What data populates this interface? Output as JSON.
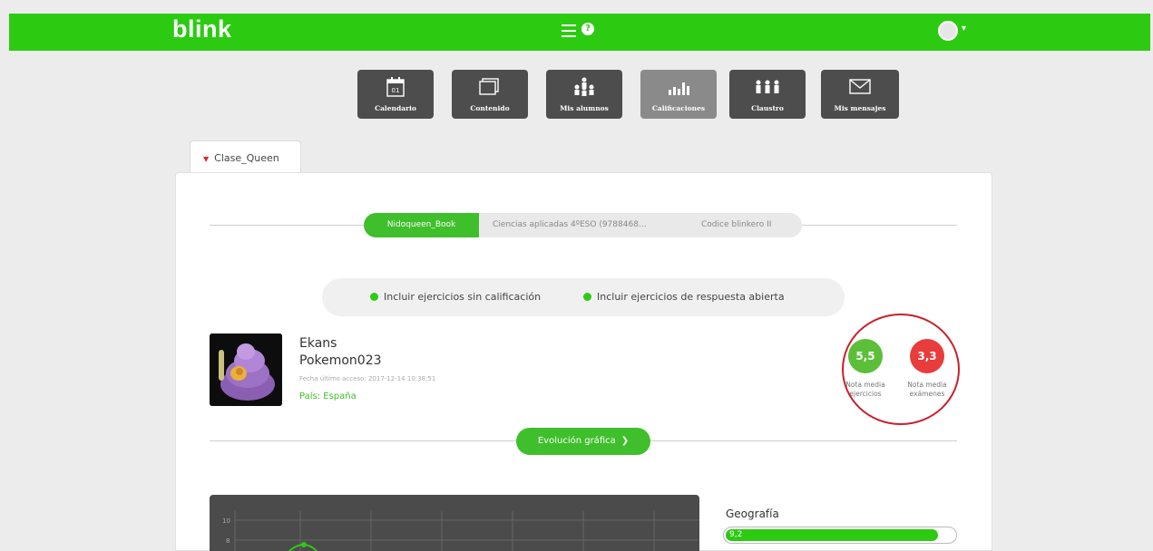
{
  "header": {
    "brand": "blink",
    "accent": "#2ccb12"
  },
  "toolbar": [
    {
      "label": "Calendario",
      "icon": "calendar-icon",
      "badge": "01"
    },
    {
      "label": "Contenido",
      "icon": "content-icon"
    },
    {
      "label": "Mis alumnos",
      "icon": "students-icon"
    },
    {
      "label": "Calificaciones",
      "icon": "grades-icon",
      "active": true
    },
    {
      "label": "Claustro",
      "icon": "staff-icon"
    },
    {
      "label": "Mis mensajes",
      "icon": "envelope-icon"
    }
  ],
  "class_tab": {
    "label": "Clase_Queen"
  },
  "books": [
    {
      "label": "Nidoqueen_Book",
      "active": true
    },
    {
      "label": "Ciencias aplicadas 4ºESO (9788468...",
      "active": false
    },
    {
      "label": "Codice blinkero II",
      "active": false
    }
  ],
  "filters": [
    {
      "label": "Incluir ejercicios sin calificación",
      "checked": true
    },
    {
      "label": "Incluir ejercicios de respuesta abierta",
      "checked": true
    }
  ],
  "student": {
    "name": "Ekans",
    "username": "Pokemon023",
    "last_access": "Fecha último acceso: 2017-12-14 10:38:51",
    "country": "País: España"
  },
  "scores": [
    {
      "value": "5,5",
      "label": "Nota media ejercicios",
      "color": "#5cbf3a"
    },
    {
      "value": "3,3",
      "label": "Nota media exámenes",
      "color": "#e93c3c"
    }
  ],
  "evolution_button": {
    "label": "Evolución gráfica"
  },
  "chart_ticks": [
    "10",
    "8"
  ],
  "subjects": [
    {
      "name": "Geografía",
      "value": "9,2",
      "fraction": 0.92
    }
  ]
}
